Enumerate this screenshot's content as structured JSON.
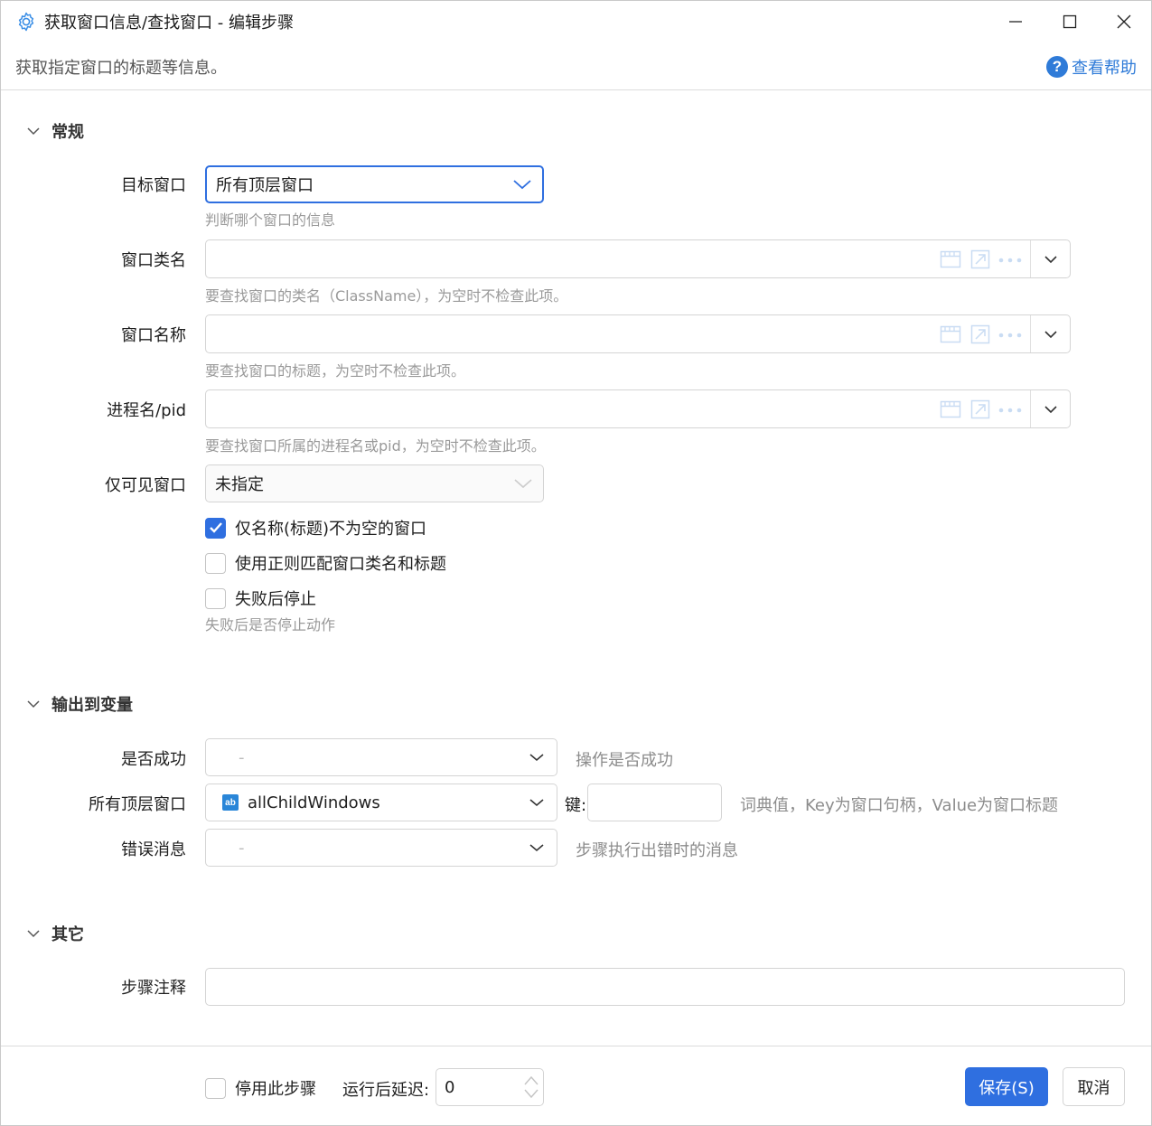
{
  "window": {
    "title": "获取窗口信息/查找窗口  -  编辑步骤",
    "description": "获取指定窗口的标题等信息。",
    "help_label": "查看帮助"
  },
  "sections": {
    "general": "常规",
    "output": "输出到变量",
    "other": "其它"
  },
  "general": {
    "target_window": {
      "label": "目标窗口",
      "value": "所有顶层窗口",
      "hint": "判断哪个窗口的信息"
    },
    "class_name": {
      "label": "窗口类名",
      "value": "",
      "hint": "要查找窗口的类名（ClassName），为空时不检查此项。"
    },
    "window_name": {
      "label": "窗口名称",
      "value": "",
      "hint": "要查找窗口的标题，为空时不检查此项。"
    },
    "process": {
      "label": "进程名/pid",
      "value": "",
      "hint": "要查找窗口所属的进程名或pid，为空时不检查此项。"
    },
    "visible_only": {
      "label": "仅可见窗口",
      "value": "未指定"
    },
    "checkboxes": [
      {
        "label": "仅名称(标题)不为空的窗口",
        "checked": true
      },
      {
        "label": "使用正则匹配窗口类名和标题",
        "checked": false
      },
      {
        "label": "失败后停止",
        "checked": false
      }
    ],
    "stop_hint": "失败后是否停止动作"
  },
  "output": {
    "success": {
      "label": "是否成功",
      "value": "-",
      "hint": "操作是否成功"
    },
    "all_windows": {
      "label": "所有顶层窗口",
      "value": "allChildWindows",
      "key_label": "键:",
      "key_value": "",
      "hint": "词典值，Key为窗口句柄，Value为窗口标题"
    },
    "error": {
      "label": "错误消息",
      "value": "-",
      "hint": "步骤执行出错时的消息"
    }
  },
  "other": {
    "comment": {
      "label": "步骤注释",
      "value": ""
    }
  },
  "footer": {
    "disable_label": "停用此步骤",
    "delay_label": "运行后延迟:",
    "delay_value": "0",
    "save_label": "保存(S)",
    "cancel_label": "取消"
  },
  "colors": {
    "accent": "#2f6fe0",
    "help_link": "#2f7bd8",
    "hint_text": "#9a9a9a"
  }
}
